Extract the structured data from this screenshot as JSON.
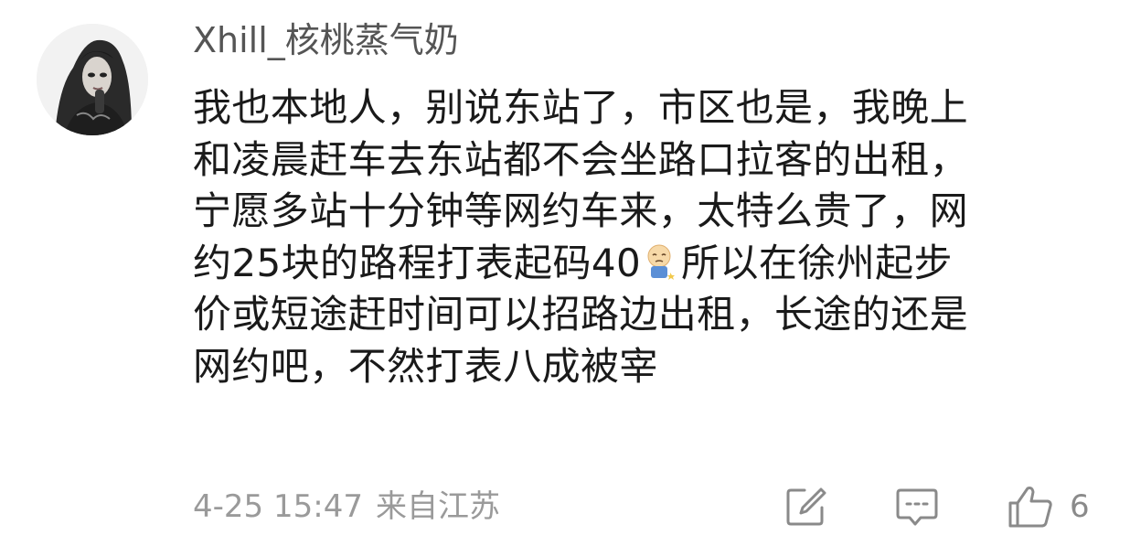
{
  "comment": {
    "username": "Xhill_核桃蒸气奶",
    "lines": [
      "我也本地人，别说东站了，市区也是，我晚上",
      "和凌晨赶车去东站都不会坐路口拉客的出租，",
      "宁愿多站十分钟等网约车来，太特么贵了，网",
      "约25块的路程打表起码40",
      "所以在徐州起步",
      "价或短途赶时间可以招路边出租，长途的还是",
      "网约吧，不然打表八成被宰"
    ],
    "emoji_icon": "sad-face-emoji-icon",
    "timestamp": "4-25 15:47",
    "location": "来自江苏",
    "like_count": "6"
  },
  "icons": {
    "share": "share-edit-icon",
    "comment": "comment-bubble-icon",
    "like": "thumbs-up-icon"
  },
  "colors": {
    "username": "#555555",
    "body": "#1a1a1a",
    "meta": "#9a9a9a",
    "icon": "#8a8a8a"
  }
}
